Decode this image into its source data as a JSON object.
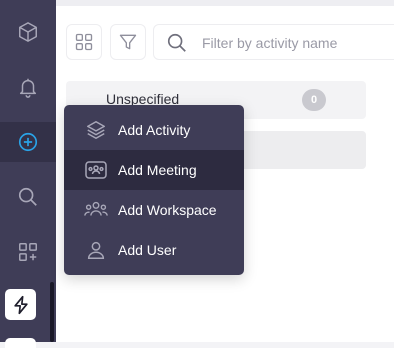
{
  "sidebar": {
    "items": [
      {
        "icon": "cube-icon"
      },
      {
        "icon": "bell-icon"
      },
      {
        "icon": "plus-circle-icon",
        "active": true
      },
      {
        "icon": "search-icon"
      },
      {
        "icon": "apps-add-icon"
      }
    ],
    "app_icon": "bolt-icon"
  },
  "toolbar": {
    "view_icon": "grid-view-icon",
    "filter_icon": "filter-icon",
    "search_placeholder": "Filter by activity name"
  },
  "groups": [
    {
      "label": "Unspecified",
      "count": "0"
    }
  ],
  "add_menu": {
    "items": [
      {
        "label": "Add Activity",
        "icon": "layers-icon"
      },
      {
        "label": "Add Meeting",
        "icon": "meeting-icon",
        "hovered": true
      },
      {
        "label": "Add Workspace",
        "icon": "workspace-icon"
      },
      {
        "label": "Add User",
        "icon": "user-icon"
      }
    ]
  },
  "colors": {
    "sidebar_bg": "#3f3d57",
    "accent": "#2aa3e8",
    "menu_hover": "#2d2b40"
  }
}
